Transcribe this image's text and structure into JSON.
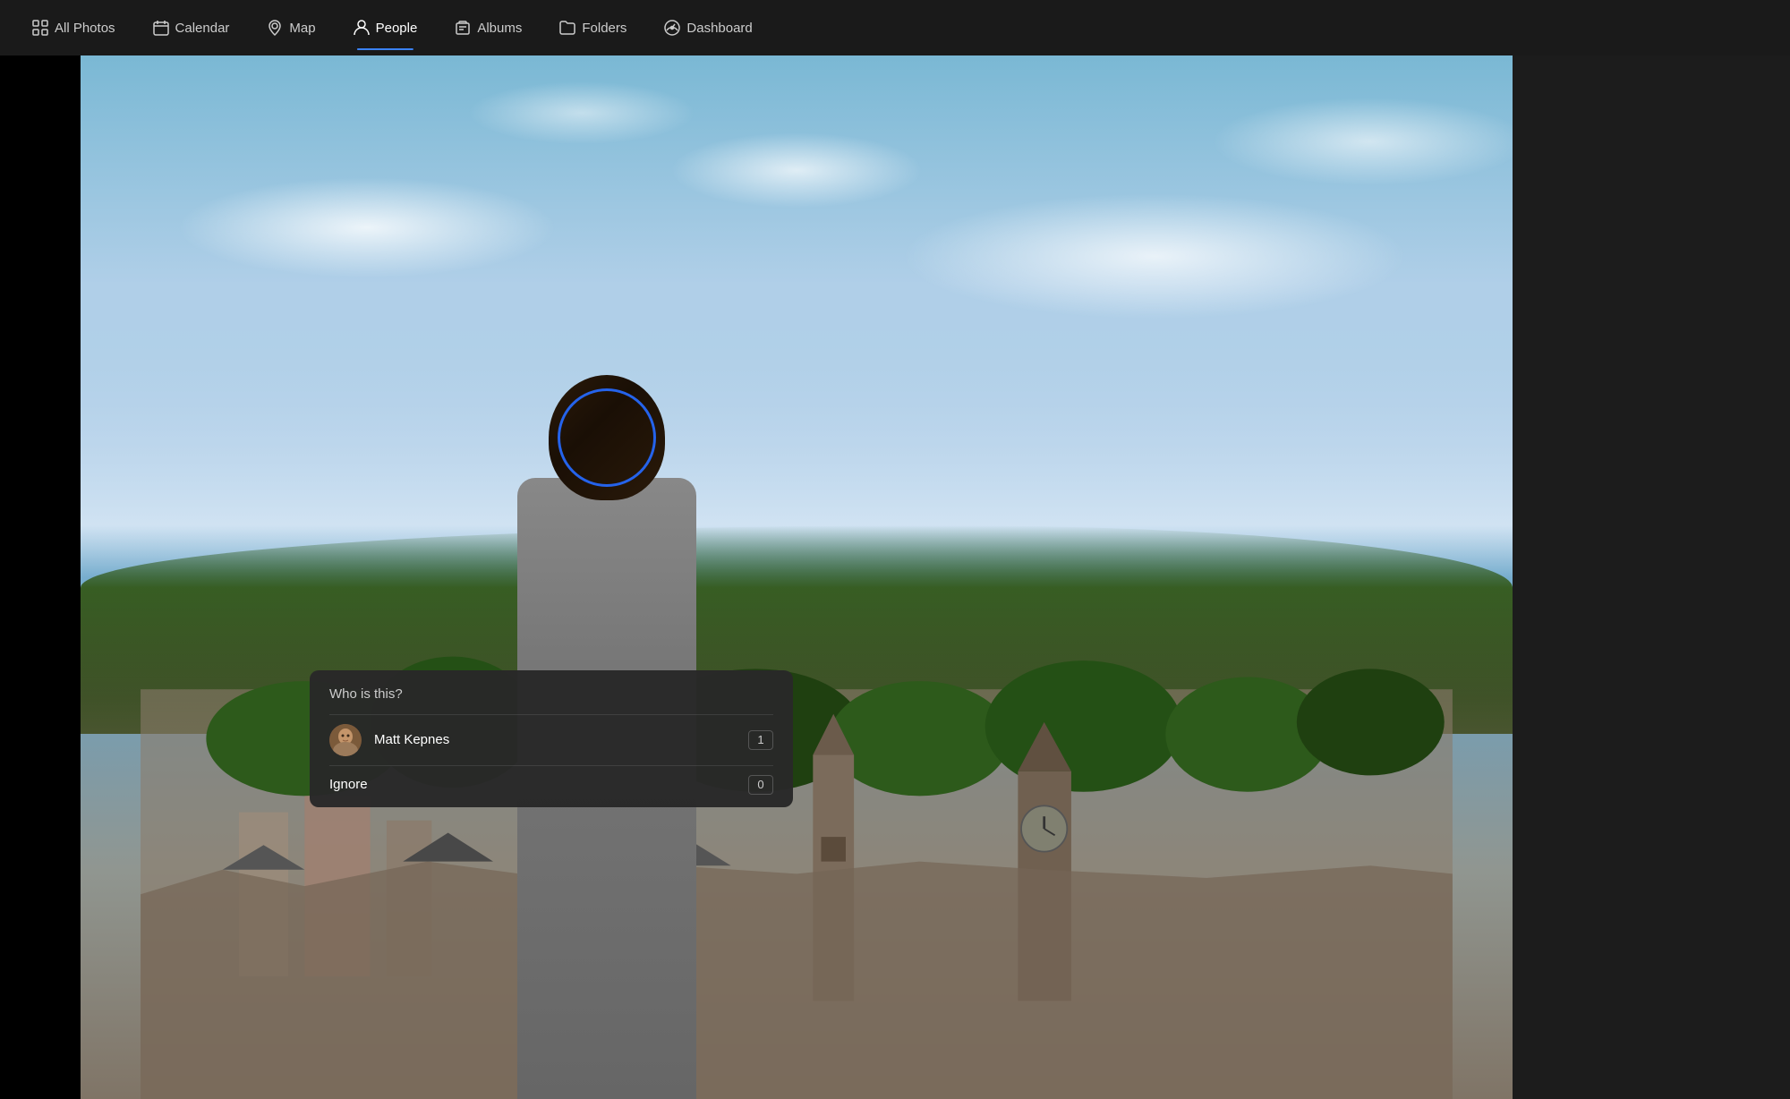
{
  "nav": {
    "items": [
      {
        "id": "all-photos",
        "label": "All Photos",
        "icon": "grid",
        "active": false
      },
      {
        "id": "calendar",
        "label": "Calendar",
        "icon": "calendar",
        "active": false
      },
      {
        "id": "map",
        "label": "Map",
        "icon": "map-pin",
        "active": false
      },
      {
        "id": "people",
        "label": "People",
        "icon": "person",
        "active": true
      },
      {
        "id": "albums",
        "label": "Albums",
        "icon": "album",
        "active": false
      },
      {
        "id": "folders",
        "label": "Folders",
        "icon": "folder",
        "active": false
      },
      {
        "id": "dashboard",
        "label": "Dashboard",
        "icon": "gauge",
        "active": false
      }
    ]
  },
  "popup": {
    "title": "Who is this?",
    "people": [
      {
        "name": "Matt Kepnes",
        "count": "1",
        "has_avatar": true
      },
      {
        "name": "Ignore",
        "count": "0",
        "has_avatar": false
      }
    ]
  },
  "colors": {
    "nav_bg": "#1a1a1a",
    "active_underline": "#2563eb",
    "face_circle": "#2563eb",
    "popup_bg": "#282828"
  }
}
